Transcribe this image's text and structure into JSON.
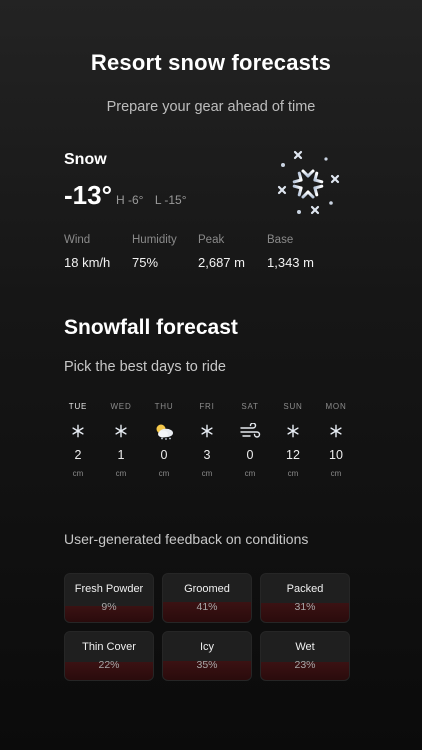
{
  "header": {
    "title": "Resort snow forecasts",
    "subtitle": "Prepare your gear ahead of time"
  },
  "current": {
    "condition": "Snow",
    "temperature": "-13°",
    "high": "H -6°",
    "low": "L -15°",
    "icon": "snowflake-icon",
    "stats": [
      {
        "label": "Wind",
        "value": "18 km/h"
      },
      {
        "label": "Humidity",
        "value": "75%"
      },
      {
        "label": "Peak",
        "value": "2,687 m"
      },
      {
        "label": "Base",
        "value": "1,343 m"
      }
    ]
  },
  "snowfall": {
    "title": "Snowfall forecast",
    "subtitle": "Pick the best days to ride",
    "days": [
      {
        "day": "TUE",
        "icon": "snowflake-icon",
        "value": "2",
        "unit": "cm",
        "active": true
      },
      {
        "day": "WED",
        "icon": "snowflake-icon",
        "value": "1",
        "unit": "cm",
        "active": false
      },
      {
        "day": "THU",
        "icon": "partly-cloudy-icon",
        "value": "0",
        "unit": "cm",
        "active": false
      },
      {
        "day": "FRI",
        "icon": "snowflake-icon",
        "value": "3",
        "unit": "cm",
        "active": false
      },
      {
        "day": "SAT",
        "icon": "wind-icon",
        "value": "0",
        "unit": "cm",
        "active": false
      },
      {
        "day": "SUN",
        "icon": "snowflake-icon",
        "value": "12",
        "unit": "cm",
        "active": false
      },
      {
        "day": "MON",
        "icon": "snowflake-icon",
        "value": "10",
        "unit": "cm",
        "active": false
      }
    ]
  },
  "feedback": {
    "title": "User-generated feedback on conditions",
    "accent_color": "#3b1213",
    "items": [
      {
        "name": "Fresh Powder",
        "percent_label": "9%",
        "percent": 9
      },
      {
        "name": "Groomed",
        "percent_label": "41%",
        "percent": 41
      },
      {
        "name": "Packed",
        "percent_label": "31%",
        "percent": 31
      },
      {
        "name": "Thin Cover",
        "percent_label": "22%",
        "percent": 22
      },
      {
        "name": "Icy",
        "percent_label": "35%",
        "percent": 35
      },
      {
        "name": "Wet",
        "percent_label": "23%",
        "percent": 23
      }
    ]
  }
}
